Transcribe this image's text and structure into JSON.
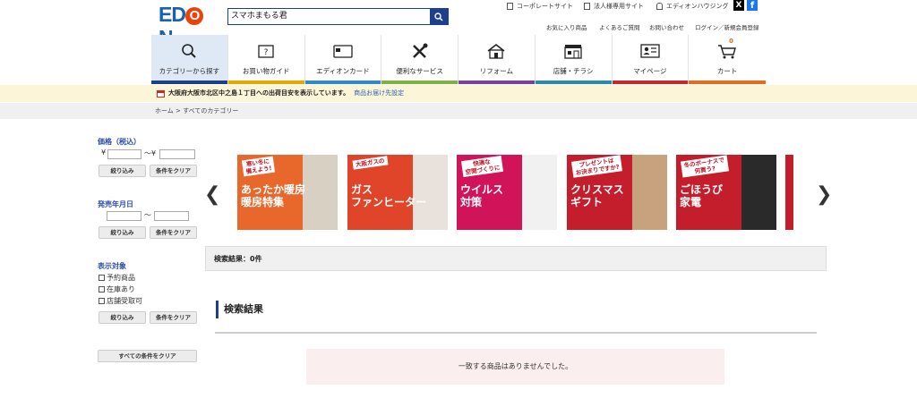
{
  "header": {
    "logo": "ED",
    "logo_o": "O",
    "logo_n": "N",
    "search_value": "スマホまもる君",
    "top_links": [
      "コーポレートサイト",
      "法人様専用サイト",
      "エディオンハウジング"
    ],
    "sub_links": [
      "お気に入り商品",
      "よくあるご質問",
      "お問い合わせ",
      "ログイン／新規会員登録"
    ],
    "social": {
      "x": "X",
      "facebook": "f"
    }
  },
  "nav": [
    {
      "label": "カテゴリーから探す",
      "icon": "search-icon",
      "color": "#1c3f8e"
    },
    {
      "label": "お買い物ガイド",
      "icon": "guide-icon",
      "color": "#e6a800"
    },
    {
      "label": "エディオンカード",
      "icon": "card-icon",
      "color": "#2e8bc7"
    },
    {
      "label": "便利なサービス",
      "icon": "tools-icon",
      "color": "#7fb241"
    },
    {
      "label": "リフォーム",
      "icon": "house-icon",
      "color": "#7b3fa0"
    },
    {
      "label": "店舗・チラシ",
      "icon": "store-icon",
      "color": "#2a8ca6"
    },
    {
      "label": "マイページ",
      "icon": "profile-icon",
      "color": "#c42a2a"
    },
    {
      "label": "カート",
      "icon": "cart-icon",
      "color": "#e86a1c",
      "badge": "0"
    }
  ],
  "notice": {
    "text": "大阪府大阪市北区中之島１丁目への出荷目安を表示しています。",
    "link": "商品お届け先設定"
  },
  "breadcrumb": {
    "home": "ホーム",
    "sep": ">",
    "current": "すべてのカテゴリー"
  },
  "sidebar": {
    "price_title": "価格（税込）",
    "yen": "¥",
    "tilde_yen": "〜¥",
    "tilde": "〜",
    "narrow_btn": "絞り込み",
    "clear_btn": "条件をクリア",
    "release_title": "発売年月日",
    "display_title": "表示対象",
    "options": [
      "予約商品",
      "在庫あり",
      "店舗受取可"
    ],
    "clear_all": "すべての条件をクリア"
  },
  "banners": [
    {
      "tag": "寒い冬に\n備えよう!",
      "main": "あったか暖房\n暖房特集",
      "bg": "#e8672a",
      "photo": "#d9d0c4"
    },
    {
      "tag": "大阪ガスの",
      "main": "ガス\nファンヒーター",
      "bg": "#e0452a",
      "photo": "#e9e2dc"
    },
    {
      "tag": "快適な\n空間づくりに",
      "main": "ウイルス\n対策",
      "bg": "#d1135a",
      "photo": "#f1f1f1"
    },
    {
      "tag": "プレゼントは\nお決まりですか?",
      "main": "クリスマス\nギフト",
      "bg": "#c41d2c",
      "photo": "#c8a27e"
    },
    {
      "tag": "冬のボーナスで\n何買う?",
      "main": "ごほうび\n家電",
      "bg": "#c41d2c",
      "photo": "#2a2a2a"
    }
  ],
  "arrows": {
    "left": "❮",
    "right": "❯"
  },
  "results": {
    "count_text": "検索結果：0件",
    "title": "検索結果",
    "empty_message": "一致する商品はありませんでした。"
  }
}
